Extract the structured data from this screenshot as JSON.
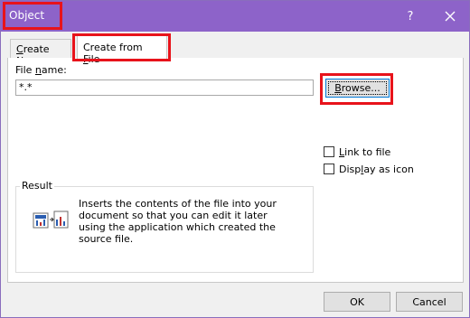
{
  "window": {
    "title": "Object"
  },
  "titlebar": {
    "help_label": "?",
    "close_label": "✕"
  },
  "tabs": [
    {
      "label_pre": "",
      "accel": "C",
      "label_post": "reate New"
    },
    {
      "label_pre": "Create from ",
      "accel": "F",
      "label_post": "ile"
    }
  ],
  "file": {
    "label_pre": "File ",
    "label_accel": "n",
    "label_post": "ame:",
    "value": "*.*",
    "browse_accel": "B",
    "browse_rest": "rowse..."
  },
  "options": {
    "link_accel": "L",
    "link_rest": "ink to file",
    "icon_pre": "Disp",
    "icon_accel": "l",
    "icon_post": "ay as icon",
    "link_checked": false,
    "icon_checked": false
  },
  "result": {
    "title": "Result",
    "description": "Inserts the contents of the file into your document so that you can edit it later using the application which created the source file."
  },
  "buttons": {
    "ok": "OK",
    "cancel": "Cancel"
  },
  "colors": {
    "titlebar": "#8d63c9",
    "highlight": "#e8131b",
    "accent": "#0078d7"
  },
  "icons": {
    "result": "object-embed-icon",
    "help": "help-icon",
    "close": "close-icon"
  }
}
